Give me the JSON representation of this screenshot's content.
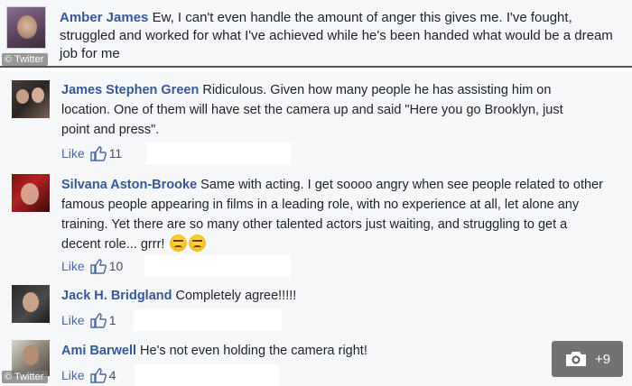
{
  "top": {
    "name": "Amber James",
    "text": "Ew, I can't even handle the amount of anger this gives me. I've fought, struggled and worked for what I've achieved while he's been handed what would be a dream job for me",
    "watermark": "© Twitter"
  },
  "comments": [
    {
      "name": "James Stephen Green",
      "text": "Ridiculous. Given how many people he has assisting him on location. One of them will have set the camera up and said \"Here you go Brooklyn, just point and press\".",
      "like_label": "Like",
      "likes": "11"
    },
    {
      "name": "Silvana Aston-Brooke",
      "text": "Same with acting. I get soooo angry when see people related to other famous people appearing in films in a leading role, with no experience at all, let alone any training. Yet there are so many other talented actors just waiting, and struggling to get a decent role... grrr!",
      "like_label": "Like",
      "likes": "10"
    },
    {
      "name": "Jack H. Bridgland",
      "text": "Completely agree!!!!!",
      "like_label": "Like",
      "likes": "1"
    },
    {
      "name": "Ami Barwell",
      "text": "He's not even holding the camera right!",
      "like_label": "Like",
      "likes": "4"
    }
  ],
  "bottom_watermark": "© Twitter",
  "gallery": {
    "count": "+9",
    "icon": "camera-icon"
  },
  "icons": {
    "like": "thumbs-up-icon",
    "emoji": "angry-face-icon"
  },
  "colors": {
    "name": "#365899",
    "background": "#f6f7f9",
    "text": "#1d2129"
  }
}
